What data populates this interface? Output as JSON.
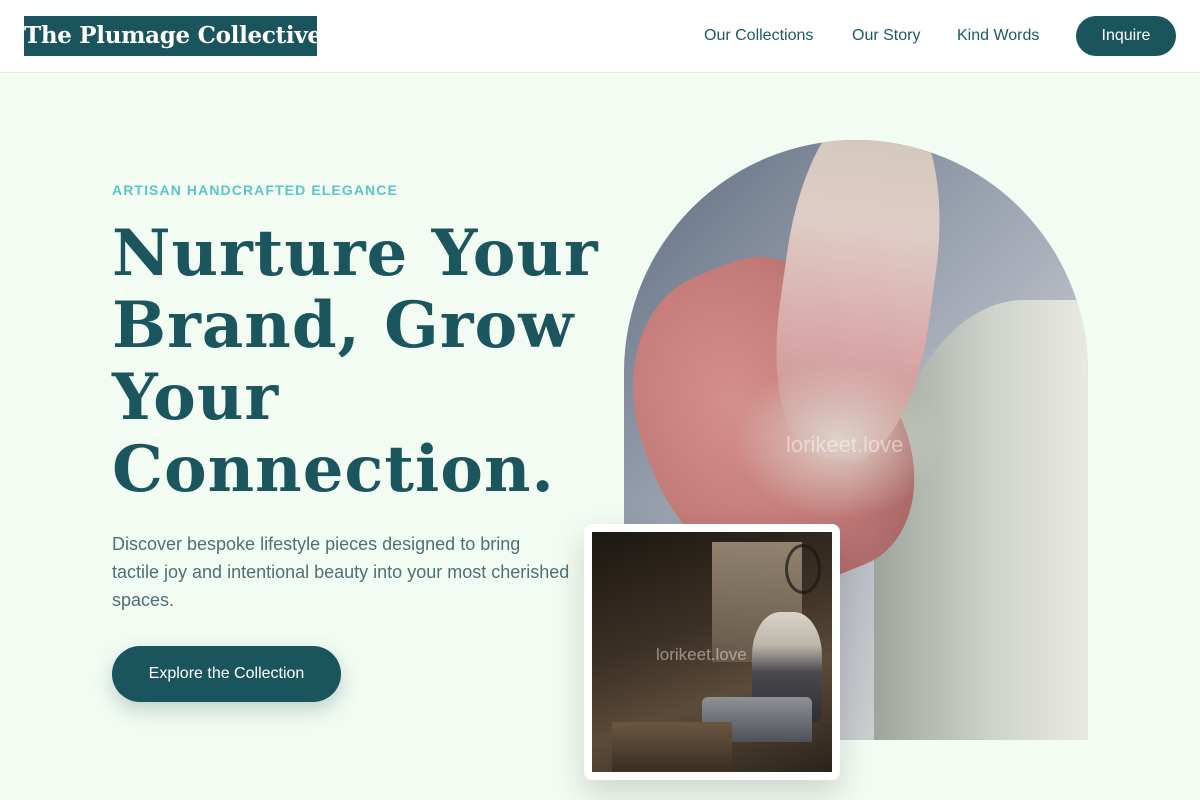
{
  "header": {
    "logo_text": "The Plumage Collective",
    "nav": [
      {
        "label": "Our Collections"
      },
      {
        "label": "Our Story"
      },
      {
        "label": "Kind Words"
      }
    ],
    "cta_label": "Inquire"
  },
  "hero": {
    "eyebrow": "ARTISAN HANDCRAFTED ELEGANCE",
    "headline_lines": [
      "Nurture Your",
      "Brand, Grow",
      "Your",
      "Connection."
    ],
    "subheading": "Discover bespoke lifestyle pieces designed to bring tactile joy and intentional beauty into your most cherished spaces.",
    "cta_label": "Explore the Collection"
  },
  "images": {
    "main_watermark": "lorikeet.love",
    "inset_watermark": "lorikeet.love"
  },
  "colors": {
    "brand": "#1a545c",
    "accent": "#5cc5c7",
    "background": "#f3fcf3"
  }
}
